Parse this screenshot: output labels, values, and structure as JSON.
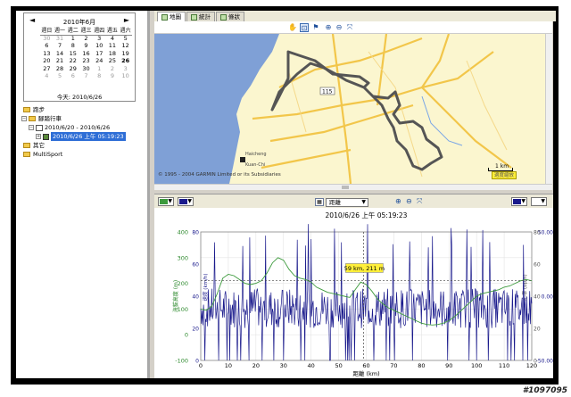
{
  "watermark": "#1097095",
  "calendar": {
    "title": "2010年6月",
    "prev": "◄",
    "next": "►",
    "weekdays": [
      "週日",
      "週一",
      "週二",
      "週三",
      "週四",
      "週五",
      "週六"
    ],
    "weeks": [
      [
        "30",
        "31",
        "1",
        "2",
        "3",
        "4",
        "5"
      ],
      [
        "6",
        "7",
        "8",
        "9",
        "10",
        "11",
        "12"
      ],
      [
        "13",
        "14",
        "15",
        "16",
        "17",
        "18",
        "19"
      ],
      [
        "20",
        "21",
        "22",
        "23",
        "24",
        "25",
        "26"
      ],
      [
        "27",
        "28",
        "29",
        "30",
        "1",
        "2",
        "3"
      ],
      [
        "4",
        "5",
        "6",
        "7",
        "8",
        "9",
        "10"
      ]
    ],
    "today_label": "今天: 2010/6/26"
  },
  "tree": {
    "items": [
      {
        "label": "跑步",
        "level": 0
      },
      {
        "label": "腳踏行車",
        "level": 0
      },
      {
        "label": "2010/6/20 - 2010/6/26",
        "level": 1
      },
      {
        "label": "2010/6/26 上午 05:19:23",
        "level": 2
      },
      {
        "label": "其它",
        "level": 0
      },
      {
        "label": "MultiSport",
        "level": 0
      }
    ]
  },
  "map_tabs": [
    {
      "label": "地圖"
    },
    {
      "label": "統計"
    },
    {
      "label": "條狀"
    }
  ],
  "map": {
    "copyright": "© 1995 - 2004 GARMIN Limited or its Subsidiaries",
    "scale": "1 km",
    "fit_button": "適度縮放",
    "road_label": "115",
    "place_labels": [
      "Haicheng",
      "Kuan-Chi"
    ],
    "colors": {
      "land": "#fbf6cf",
      "sea": "#7fa0d6",
      "road": "#f2c64a",
      "track": "#555555"
    }
  },
  "chart_controls": {
    "x_mode": "距離",
    "arrow": "▼"
  },
  "chart_data": {
    "type": "line",
    "title": "2010/6/26 上午 05:19:23",
    "xlabel": "距離 (km)",
    "ylabel_left": "海拔高度 (m)",
    "ylabel_left_inner": "速度 (km/h)",
    "ylabel_right": "高度梯度",
    "ylabel_right_inner": "心率 (bpm)",
    "xlim": [
      0,
      120
    ],
    "x_ticks": [
      "0",
      "10",
      "20",
      "30",
      "40",
      "50",
      "60",
      "70",
      "80",
      "90",
      "100",
      "110",
      "120"
    ],
    "ylim_left": [
      -100,
      400
    ],
    "y_ticks_left": [
      "-100",
      "0",
      "100",
      "200",
      "300",
      "400"
    ],
    "y_ticks_left_inner": [
      "0",
      "20",
      "40",
      "60",
      "80"
    ],
    "y_ticks_right": [
      "-50.00",
      "0.00",
      "50.00"
    ],
    "y_ticks_right_inner": [
      "0",
      "20",
      "40",
      "60",
      "80"
    ],
    "cursor": {
      "x": 59,
      "y": 211,
      "label": "59 km, 211 m"
    },
    "elevation": {
      "name": "海拔高度",
      "color": "#3c9a3c",
      "x": [
        0,
        2,
        4,
        6,
        8,
        10,
        12,
        14,
        16,
        18,
        20,
        22,
        24,
        26,
        28,
        30,
        32,
        34,
        36,
        38,
        40,
        42,
        44,
        46,
        48,
        50,
        52,
        54,
        56,
        58,
        60,
        62,
        64,
        66,
        68,
        70,
        72,
        74,
        76,
        78,
        80,
        82,
        84,
        86,
        88,
        90,
        92,
        94,
        96,
        98,
        100,
        102,
        104,
        106,
        108,
        110,
        112,
        114,
        116,
        118,
        120
      ],
      "y": [
        100,
        95,
        110,
        160,
        220,
        235,
        230,
        215,
        200,
        195,
        200,
        210,
        240,
        280,
        300,
        290,
        255,
        230,
        220,
        215,
        205,
        185,
        175,
        165,
        160,
        155,
        150,
        145,
        175,
        205,
        195,
        170,
        140,
        120,
        105,
        95,
        85,
        75,
        65,
        55,
        45,
        40,
        38,
        40,
        45,
        55,
        70,
        90,
        110,
        130,
        150,
        160,
        165,
        170,
        175,
        185,
        190,
        200,
        210,
        215,
        210
      ]
    },
    "speed": {
      "name": "速度",
      "color": "#1a1a8c"
    }
  }
}
